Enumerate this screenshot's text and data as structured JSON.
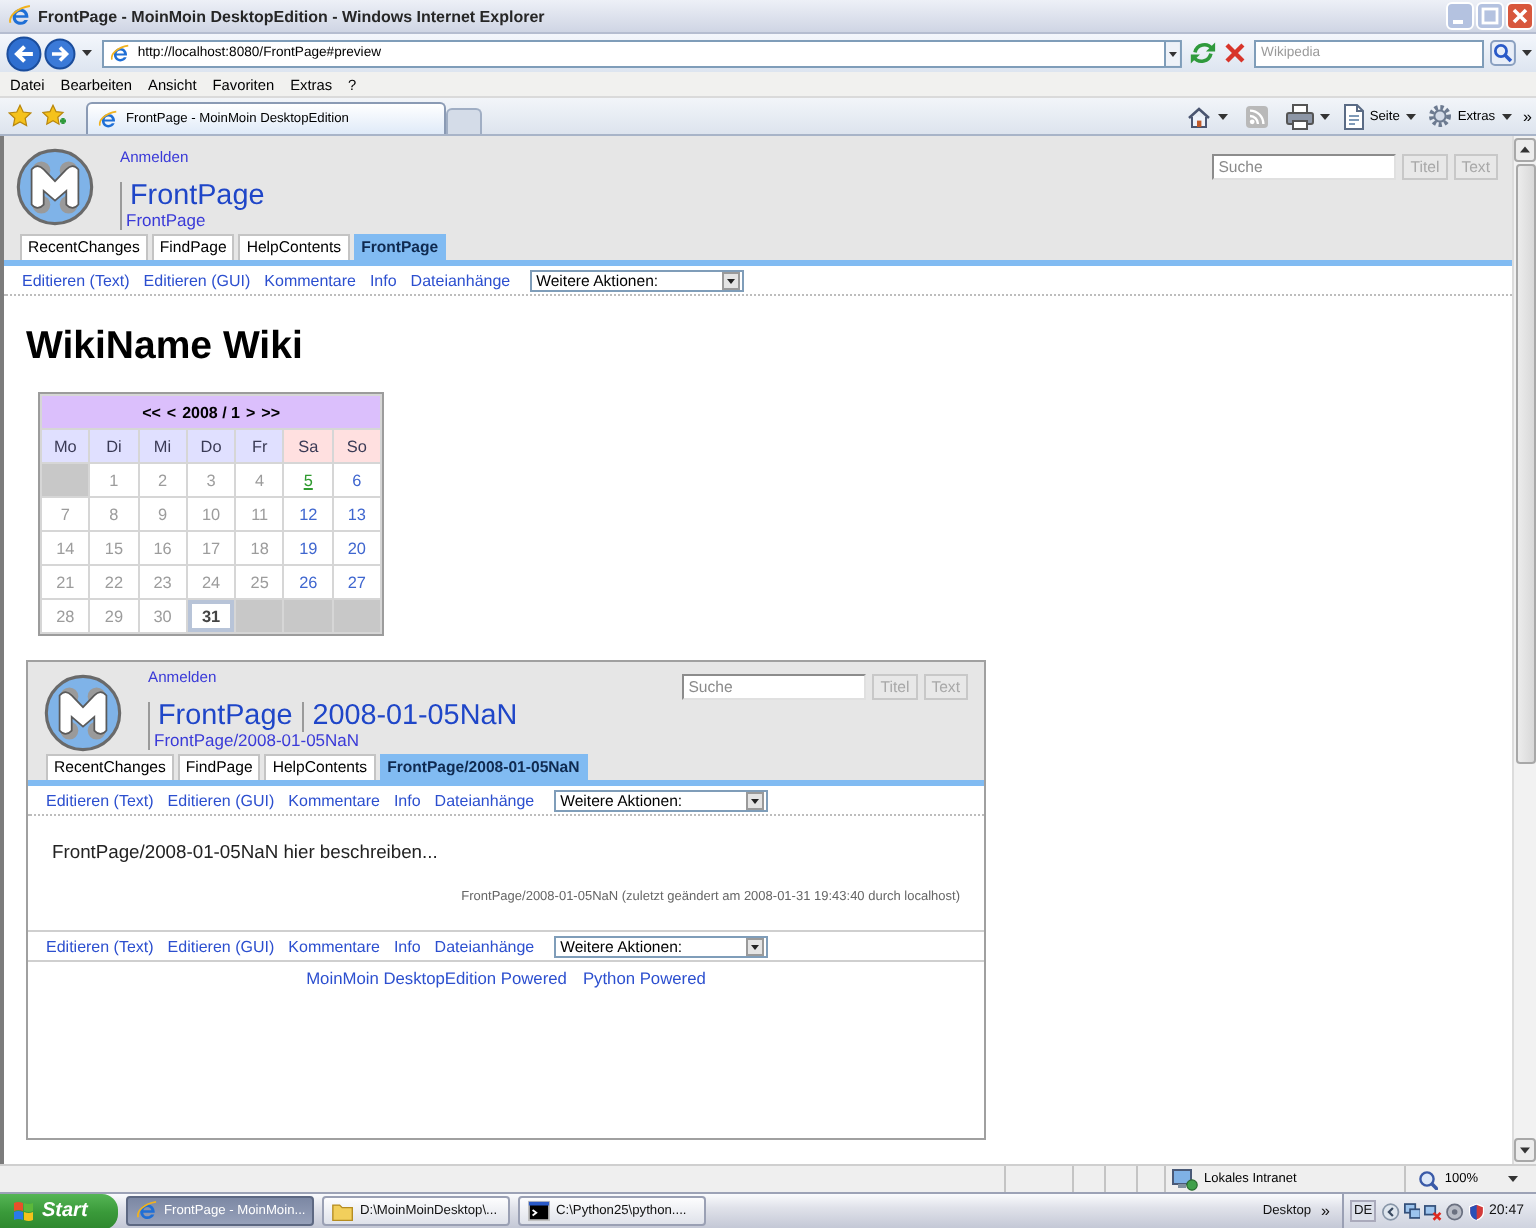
{
  "window": {
    "title": "FrontPage - MoinMoin DesktopEdition - Windows Internet Explorer"
  },
  "address_bar": {
    "url": "http://localhost:8080/FrontPage#preview"
  },
  "search_box": {
    "placeholder": "Wikipedia"
  },
  "menu_bar": [
    "Datei",
    "Bearbeiten",
    "Ansicht",
    "Favoriten",
    "Extras",
    "?"
  ],
  "browser_tabs": [
    {
      "label": "FrontPage - MoinMoin DesktopEdition",
      "selected": true
    }
  ],
  "command_bar": [
    {
      "kind": "home"
    },
    {
      "kind": "feeds"
    },
    {
      "kind": "print"
    },
    {
      "kind": "page",
      "label": "Seite"
    },
    {
      "kind": "tools",
      "label": "Extras"
    },
    {
      "kind": "overflow",
      "label": "»"
    }
  ],
  "page": {
    "login_link": "Anmelden",
    "title_parts": [
      "FrontPage"
    ],
    "breadcrumb": "FrontPage",
    "search": {
      "placeholder": "Suche",
      "buttons": [
        {
          "label": "Titel",
          "disabled": true
        },
        {
          "label": "Text",
          "disabled": true
        }
      ]
    },
    "nav_tabs": [
      {
        "label": "RecentChanges",
        "selected": false
      },
      {
        "label": "FindPage",
        "selected": false
      },
      {
        "label": "HelpContents",
        "selected": false
      },
      {
        "label": "FrontPage",
        "selected": true
      }
    ],
    "actions": [
      "Editieren (Text)",
      "Editieren (GUI)",
      "Kommentare",
      "Info",
      "Dateianhänge"
    ],
    "more_actions": "Weitere Aktionen:",
    "heading": "WikiName Wiki",
    "calendar": {
      "prev_year": "<<",
      "prev_month": "<",
      "month": "2008 / 1",
      "next_month": ">",
      "next_year": ">>",
      "weekdays": [
        {
          "label": "Mo",
          "kind": "weekday"
        },
        {
          "label": "Di",
          "kind": "weekday"
        },
        {
          "label": "Mi",
          "kind": "weekday"
        },
        {
          "label": "Do",
          "kind": "weekday"
        },
        {
          "label": "Fr",
          "kind": "weekday"
        },
        {
          "label": "Sa",
          "kind": "weekend"
        },
        {
          "label": "So",
          "kind": "weekend"
        }
      ],
      "weeks": [
        [
          {
            "kind": "blank"
          },
          {
            "day": "1",
            "kind": "day"
          },
          {
            "day": "2",
            "kind": "day"
          },
          {
            "day": "3",
            "kind": "day"
          },
          {
            "day": "4",
            "kind": "day"
          },
          {
            "day": "5",
            "kind": "page"
          },
          {
            "day": "6",
            "kind": "weekend"
          }
        ],
        [
          {
            "day": "7",
            "kind": "day"
          },
          {
            "day": "8",
            "kind": "day"
          },
          {
            "day": "9",
            "kind": "day"
          },
          {
            "day": "10",
            "kind": "day"
          },
          {
            "day": "11",
            "kind": "day"
          },
          {
            "day": "12",
            "kind": "weekend"
          },
          {
            "day": "13",
            "kind": "weekend"
          }
        ],
        [
          {
            "day": "14",
            "kind": "day"
          },
          {
            "day": "15",
            "kind": "day"
          },
          {
            "day": "16",
            "kind": "day"
          },
          {
            "day": "17",
            "kind": "day"
          },
          {
            "day": "18",
            "kind": "day"
          },
          {
            "day": "19",
            "kind": "weekend"
          },
          {
            "day": "20",
            "kind": "weekend"
          }
        ],
        [
          {
            "day": "21",
            "kind": "day"
          },
          {
            "day": "22",
            "kind": "day"
          },
          {
            "day": "23",
            "kind": "day"
          },
          {
            "day": "24",
            "kind": "day"
          },
          {
            "day": "25",
            "kind": "day"
          },
          {
            "day": "26",
            "kind": "weekend"
          },
          {
            "day": "27",
            "kind": "weekend"
          }
        ],
        [
          {
            "day": "28",
            "kind": "day"
          },
          {
            "day": "29",
            "kind": "day"
          },
          {
            "day": "30",
            "kind": "day"
          },
          {
            "day": "31",
            "kind": "today"
          },
          {
            "kind": "blank"
          },
          {
            "kind": "blank"
          },
          {
            "kind": "blank"
          }
        ]
      ]
    },
    "preview": {
      "login_link": "Anmelden",
      "title_parts": [
        "FrontPage",
        "2008-01-05NaN"
      ],
      "breadcrumb": "FrontPage/2008-01-05NaN",
      "search": {
        "placeholder": "Suche",
        "buttons": [
          {
            "label": "Titel",
            "disabled": true
          },
          {
            "label": "Text",
            "disabled": true
          }
        ]
      },
      "nav_tabs": [
        {
          "label": "RecentChanges",
          "selected": false
        },
        {
          "label": "FindPage",
          "selected": false
        },
        {
          "label": "HelpContents",
          "selected": false
        },
        {
          "label": "FrontPage/2008-01-05NaN",
          "selected": true
        }
      ],
      "actions": [
        "Editieren (Text)",
        "Editieren (GUI)",
        "Kommentare",
        "Info",
        "Dateianhänge"
      ],
      "more_actions": "Weitere Aktionen:",
      "body": "FrontPage/2008-01-05NaN hier beschreiben...",
      "page_info": "FrontPage/2008-01-05NaN (zuletzt geändert am 2008-01-31 19:43:40 durch localhost)",
      "bottom_actions": [
        "Editieren (Text)",
        "Editieren (GUI)",
        "Kommentare",
        "Info",
        "Dateianhänge"
      ],
      "bottom_more_actions": "Weitere Aktionen:",
      "footer_links": [
        "MoinMoin DesktopEdition Powered",
        "Python Powered"
      ]
    }
  },
  "status_bar": {
    "zone": "Lokales Intranet",
    "zoom": "100%"
  },
  "taskbar": {
    "start": "Start",
    "tasks": [
      {
        "label": "FrontPage - MoinMoin...",
        "kind": "browser",
        "selected": true
      },
      {
        "label": "D:\\MoinMoinDesktop\\...",
        "kind": "folder",
        "selected": false
      },
      {
        "label": "C:\\Python25\\python....",
        "kind": "console",
        "selected": false
      }
    ],
    "desktop": "Desktop",
    "overflow": "»",
    "language": "DE",
    "clock": "20:47"
  }
}
